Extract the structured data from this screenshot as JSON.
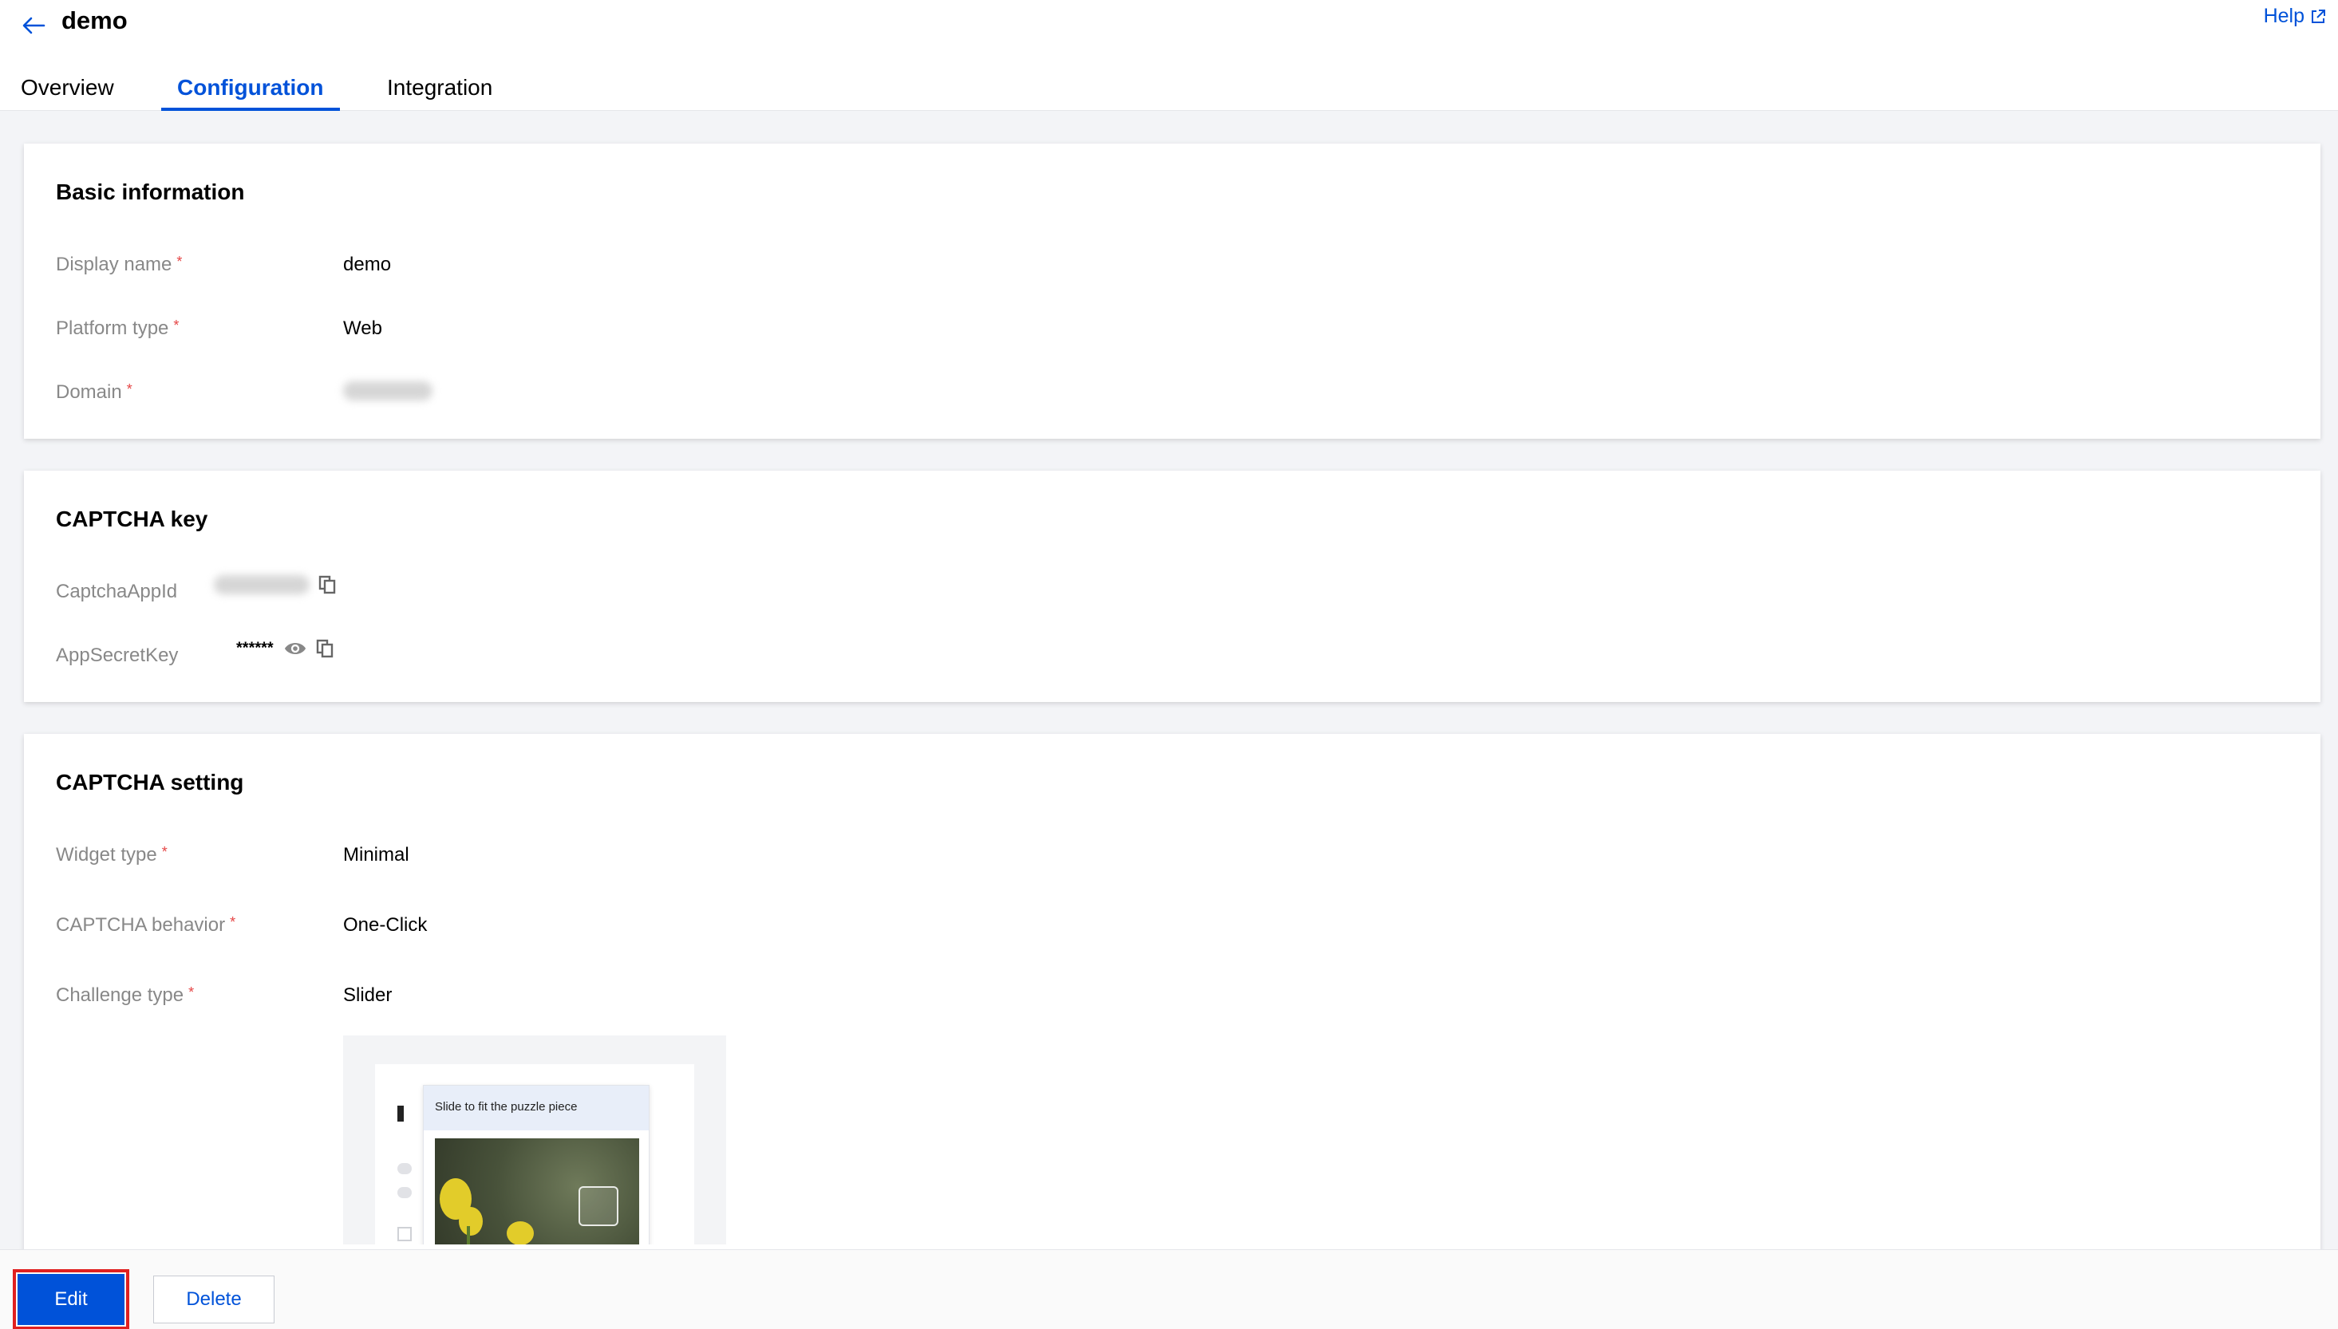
{
  "header": {
    "title": "demo",
    "help_label": "Help"
  },
  "tabs": [
    {
      "label": "Overview",
      "active": false
    },
    {
      "label": "Configuration",
      "active": true
    },
    {
      "label": "Integration",
      "active": false
    }
  ],
  "basic_info": {
    "title": "Basic information",
    "fields": [
      {
        "label": "Display name",
        "required": true,
        "value": "demo"
      },
      {
        "label": "Platform type",
        "required": true,
        "value": "Web"
      },
      {
        "label": "Domain",
        "required": true,
        "value": "",
        "masked": true
      }
    ]
  },
  "captcha_key": {
    "title": "CAPTCHA key",
    "app_id_label": "CaptchaAppId",
    "app_id_masked": true,
    "secret_label": "AppSecretKey",
    "secret_value": "******"
  },
  "captcha_setting": {
    "title": "CAPTCHA setting",
    "fields": [
      {
        "label": "Widget type",
        "required": true,
        "value": "Minimal"
      },
      {
        "label": "CAPTCHA behavior",
        "required": true,
        "value": "One-Click"
      },
      {
        "label": "Challenge type",
        "required": true,
        "value": "Slider"
      }
    ],
    "preview_prompt": "Slide to fit the puzzle piece"
  },
  "footer": {
    "edit_label": "Edit",
    "delete_label": "Delete"
  },
  "required_marker": "*",
  "colors": {
    "accent": "#0052d9",
    "required": "#e54545",
    "highlight_outline": "#e02020",
    "label": "#888888",
    "background": "#f3f4f7"
  },
  "icons": [
    "arrow-left-icon",
    "external-link-icon",
    "copy-icon",
    "eye-icon"
  ]
}
